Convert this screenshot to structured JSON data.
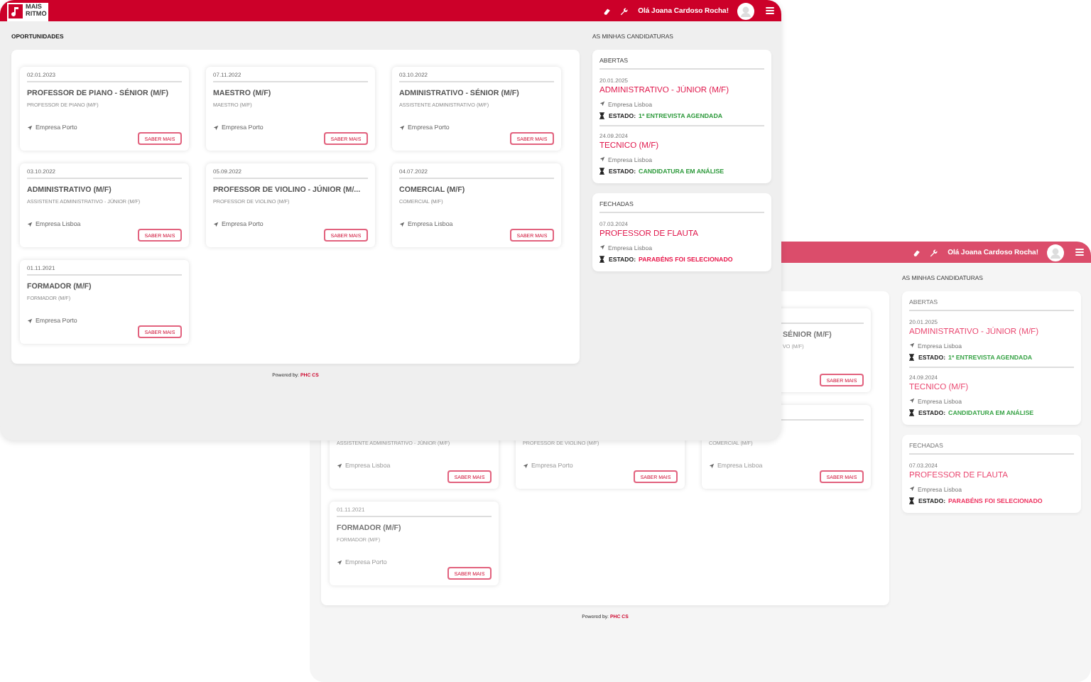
{
  "windows": [
    {
      "kind": "front",
      "header": {
        "logo": {
          "line_1": "MAIS",
          "line_2": "RITMO"
        },
        "greeting": "Olá Joana Cardoso Rocha!"
      },
      "opportunities": {
        "heading": "OPORTUNIDADES",
        "cards": [
          {
            "date": "02.01.2023",
            "title": "PROFESSOR DE PIANO - SÉNIOR (M/F)",
            "subtitle": "PROFESSOR DE PIANO (M/F)",
            "location": "Empresa Porto",
            "button": "SABER MAIS"
          },
          {
            "date": "07.11.2022",
            "title": "MAESTRO (M/F)",
            "subtitle": "MAESTRO (M/F)",
            "location": "Empresa Porto",
            "button": "SABER MAIS"
          },
          {
            "date": "03.10.2022",
            "title": "ADMINISTRATIVO - SÉNIOR (M/F)",
            "subtitle": "ASSISTENTE ADMINISTRATIVO (M/F)",
            "location": "Empresa Porto",
            "button": "SABER MAIS"
          },
          {
            "date": "03.10.2022",
            "title": "ADMINISTRATIVO (M/F)",
            "subtitle": "ASSISTENTE ADMINISTRATIVO - JÚNIOR (M/F)",
            "location": "Empresa Lisboa",
            "button": "SABER MAIS"
          },
          {
            "date": "05.09.2022",
            "title": "PROFESSOR DE VIOLINO - JÚNIOR (M/...",
            "subtitle": "PROFESSOR DE VIOLINO (M/F)",
            "location": "Empresa Porto",
            "button": "SABER MAIS"
          },
          {
            "date": "04.07.2022",
            "title": "COMERCIAL (M/F)",
            "subtitle": "COMERCIAL (M/F)",
            "location": "Empresa Lisboa",
            "button": "SABER MAIS"
          },
          {
            "date": "01.11.2021",
            "title": "FORMADOR (M/F)",
            "subtitle": "FORMADOR (M/F)",
            "location": "Empresa Porto",
            "button": "SABER MAIS"
          }
        ]
      },
      "applications": {
        "heading": "AS MINHAS CANDIDATURAS",
        "groups": [
          {
            "title": "ABERTAS",
            "items": [
              {
                "date": "20.01.2025",
                "title": "ADMINISTRATIVO - JÚNIOR (M/F)",
                "location": "Empresa Lisboa",
                "status_label": "ESTADO:",
                "status": "1ª ENTREVISTA AGENDADA",
                "color": "#2e9a3c"
              },
              {
                "date": "24.09.2024",
                "title": "TECNICO (M/F)",
                "location": "Empresa Lisboa",
                "status_label": "ESTADO:",
                "status": "CANDIDATURA EM ANÁLISE",
                "color": "#2e9a3c"
              }
            ]
          },
          {
            "title": "FECHADAS",
            "items": [
              {
                "date": "07.03.2024",
                "title": "PROFESSOR DE FLAUTA",
                "location": "Empresa Lisboa",
                "status_label": "ESTADO:",
                "status": "PARABÉNS FOI SELECIONADO",
                "color": "#e8174a"
              }
            ]
          }
        ]
      },
      "footer": {
        "powered_by": "Powered by:",
        "brand": "PHC CS"
      }
    },
    {
      "kind": "back",
      "header": {
        "greeting": "Olá Joana Cardoso Rocha!"
      },
      "opportunities": {
        "cards": [
          {
            "title": "SÉNIOR (M/F)",
            "subtitle": "VO (M/F)",
            "button": "SABER MAIS"
          },
          {
            "subtitle": "ASSISTENTE ADMINISTRATIVO - JÚNIOR (M/F)",
            "location": "Empresa Lisboa",
            "button": "SABER MAIS"
          },
          {
            "subtitle": "PROFESSOR DE VIOLINO (M/F)",
            "location": "Empresa Porto",
            "button": "SABER MAIS"
          },
          {
            "subtitle": "COMERCIAL (M/F)",
            "location": "Empresa Lisboa",
            "button": "SABER MAIS"
          },
          {
            "date": "01.11.2021",
            "title": "FORMADOR (M/F)",
            "subtitle": "FORMADOR (M/F)",
            "location": "Empresa Porto",
            "button": "SABER MAIS"
          }
        ]
      },
      "applications": {
        "heading": "AS MINHAS CANDIDATURAS",
        "groups": [
          {
            "title": "ABERTAS",
            "items": [
              {
                "date": "20.01.2025",
                "title": "ADMINISTRATIVO - JÚNIOR (M/F)",
                "location": "Empresa Lisboa",
                "status_label": "ESTADO:",
                "status": "1ª ENTREVISTA AGENDADA",
                "color": "#3aa448"
              },
              {
                "date": "24.09.2024",
                "title": "TECNICO (M/F)",
                "location": "Empresa Lisboa",
                "status_label": "ESTADO:",
                "status": "CANDIDATURA EM ANÁLISE",
                "color": "#3aa448"
              }
            ]
          },
          {
            "title": "FECHADAS",
            "items": [
              {
                "date": "07.03.2024",
                "title": "PROFESSOR DE FLAUTA",
                "location": "Empresa Lisboa",
                "status_label": "ESTADO:",
                "status": "PARABÉNS FOI SELECIONADO",
                "color": "#ee3360"
              }
            ]
          }
        ]
      },
      "footer": {
        "powered_by": "Powered by:",
        "brand": "PHC CS"
      }
    }
  ]
}
